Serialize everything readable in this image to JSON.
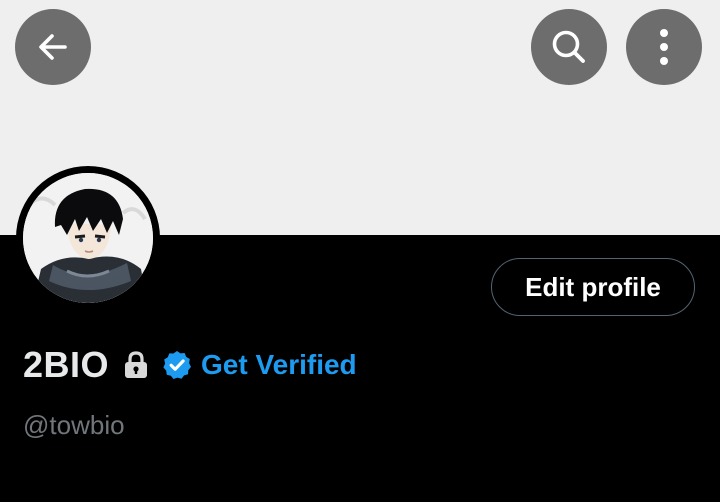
{
  "header": {
    "back_icon": "arrow-left-icon",
    "search_icon": "search-icon",
    "more_icon": "more-vertical-icon"
  },
  "profile": {
    "avatar": "anime-character-avatar",
    "display_name": "2BIO",
    "lock_icon": "lock-icon",
    "verified_badge_icon": "verified-badge-icon",
    "get_verified_label": "Get Verified",
    "handle": "@towbio",
    "edit_profile_label": "Edit profile"
  },
  "colors": {
    "banner": "#efefef",
    "background": "#000000",
    "header_button": "#6d6d6d",
    "accent": "#1d9bf0",
    "secondary_text": "#71767b",
    "button_border": "#536471"
  }
}
